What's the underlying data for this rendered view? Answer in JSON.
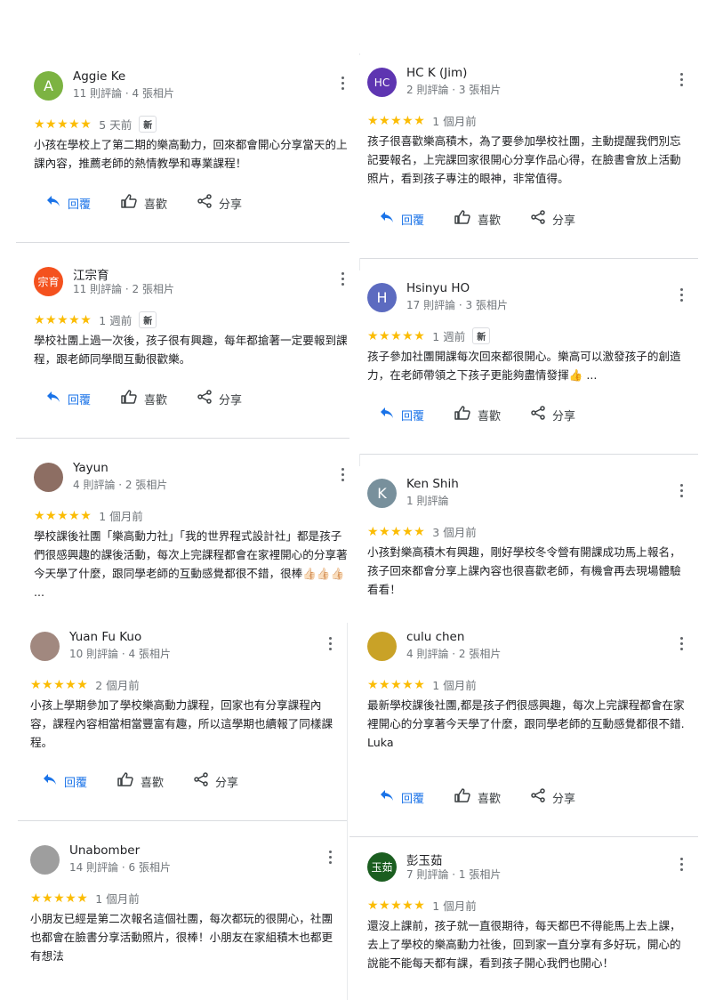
{
  "labels": {
    "reply": "回覆",
    "like": "喜歡",
    "share": "分享",
    "new_badge": "新"
  },
  "colors": {
    "star": "#fbbc04",
    "reply": "#1a73e8",
    "muted": "#70757a"
  },
  "reviews": [
    {
      "name": "Aggie Ke",
      "meta": "11 則評論 · 4 張相片",
      "avatar_letter": "A",
      "avatar_color": "#7cb342",
      "stars": "★★★★★",
      "when": "5 天前",
      "is_new": true,
      "text": "小孩在學校上了第二期的樂高動力，回來都會開心分享當天的上課內容，推薦老師的熱情教學和專業課程！"
    },
    {
      "name": "江宗育",
      "meta": "11 則評論 · 2 張相片",
      "avatar_letter": "宗育",
      "avatar_color": "#f4511e",
      "stars": "★★★★★",
      "when": "1 週前",
      "is_new": true,
      "text": "學校社團上過一次後，孩子很有興趣，每年都搶著一定要報到課程，跟老師同學間互動很歡樂。"
    },
    {
      "name": "Yayun",
      "meta": "4 則評論 · 2 張相片",
      "avatar_letter": "",
      "avatar_color": "#8d6e63",
      "stars": "★★★★★",
      "when": "1 個月前",
      "is_new": false,
      "text": "學校課後社團「樂高動力社」「我的世界程式設計社」都是孩子們很感興趣的課後活動，每次上完課程都會在家裡開心的分享著今天學了什麼，跟同學老師的互動感覺都很不錯，很棒👍🏻👍🏻👍🏻 ..."
    },
    {
      "name": "Yuan Fu Kuo",
      "meta": "10 則評論 · 4 張相片",
      "avatar_letter": "",
      "avatar_color": "#a1887f",
      "stars": "★★★★★",
      "when": "2 個月前",
      "is_new": false,
      "text": "小孩上學期參加了學校樂高動力課程，回家也有分享課程內容，課程內容相當相當豐富有趣，所以這學期也續報了同樣課程。"
    },
    {
      "name": "Unabomber",
      "meta": "14 則評論 · 6 張相片",
      "avatar_letter": "",
      "avatar_color": "#9e9e9e",
      "stars": "★★★★★",
      "when": "1 個月前",
      "is_new": false,
      "text": "小朋友已經是第二次報名這個社團，每次都玩的很開心，社團也都會在臉書分享活動照片，很棒！小朋友在家組積木也都更有想法"
    },
    {
      "name": "HC K (Jim)",
      "meta": "2 則評論 · 3 張相片",
      "avatar_letter": "HC",
      "avatar_color": "#5e35b1",
      "stars": "★★★★★",
      "when": "1 個月前",
      "is_new": false,
      "text": "孩子很喜歡樂高積木，為了要參加學校社團，主動提醒我們別忘記要報名，上完課回家很開心分享作品心得，在臉書會放上活動照片，看到孩子專注的眼神，非常值得。"
    },
    {
      "name": "Hsinyu HO",
      "meta": "17 則評論 · 3 張相片",
      "avatar_letter": "H",
      "avatar_color": "#5c6bc0",
      "stars": "★★★★★",
      "when": "1 週前",
      "is_new": true,
      "text": "孩子參加社團開課每次回來都很開心。樂高可以激發孩子的創造力，在老師帶領之下孩子更能夠盡情發揮👍 ..."
    },
    {
      "name": "Ken Shih",
      "meta": "1 則評論",
      "avatar_letter": "K",
      "avatar_color": "#78909c",
      "stars": "★★★★★",
      "when": "3 個月前",
      "is_new": false,
      "text": "小孩對樂高積木有興趣，剛好學校冬令營有開課成功馬上報名，孩子回來都會分享上課內容也很喜歡老師，有機會再去現場體驗看看！"
    },
    {
      "name": "culu chen",
      "meta": "4 則評論 · 2 張相片",
      "avatar_letter": "",
      "avatar_color": "#c9a227",
      "stars": "★★★★★",
      "when": "1 個月前",
      "is_new": false,
      "text": "最新學校課後社團,都是孩子們很感興趣，每次上完課程都會在家裡開心的分享著今天學了什麼，跟同學老師的互動感覺都很不錯.\nLuka"
    },
    {
      "name": "彭玉茹",
      "meta": "7 則評論 · 1 張相片",
      "avatar_letter": "玉茹",
      "avatar_color": "#1b5e20",
      "stars": "★★★★★",
      "when": "1 個月前",
      "is_new": false,
      "text": "還沒上課前，孩子就一直很期待，每天都巴不得能馬上去上課，去上了學校的樂高動力社後，回到家一直分享有多好玩，開心的說能不能每天都有課，看到孩子開心我們也開心！"
    }
  ]
}
